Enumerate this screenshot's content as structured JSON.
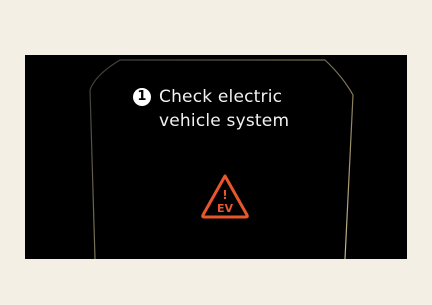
{
  "screen": {
    "message": {
      "number": "1",
      "line1": "Check electric",
      "line2": "vehicle system"
    },
    "warning": {
      "icon": "ev-warning-triangle-icon",
      "label": "EV",
      "mark": "!"
    }
  },
  "colors": {
    "background": "#f4efe4",
    "display": "#000000",
    "text": "#f2f2f2",
    "warning": "#e8572b",
    "outline": "#6a6450"
  }
}
